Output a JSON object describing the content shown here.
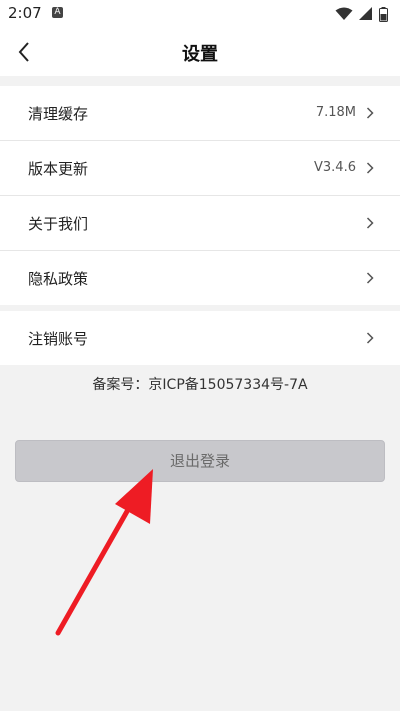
{
  "status_bar": {
    "time": "2:07",
    "notif_letter": "A"
  },
  "header": {
    "title": "设置"
  },
  "settings_group_1": [
    {
      "label": "清理缓存",
      "value": "7.18M"
    },
    {
      "label": "版本更新",
      "value": "V3.4.6"
    },
    {
      "label": "关于我们",
      "value": ""
    },
    {
      "label": "隐私政策",
      "value": ""
    }
  ],
  "settings_group_2": [
    {
      "label": "注销账号",
      "value": ""
    }
  ],
  "record_number": "备案号：京ICP备15057334号-7A",
  "logout_label": "退出登录",
  "colors": {
    "annotation_arrow": "#ee1c24",
    "logout_bg": "#c8c8cc"
  }
}
